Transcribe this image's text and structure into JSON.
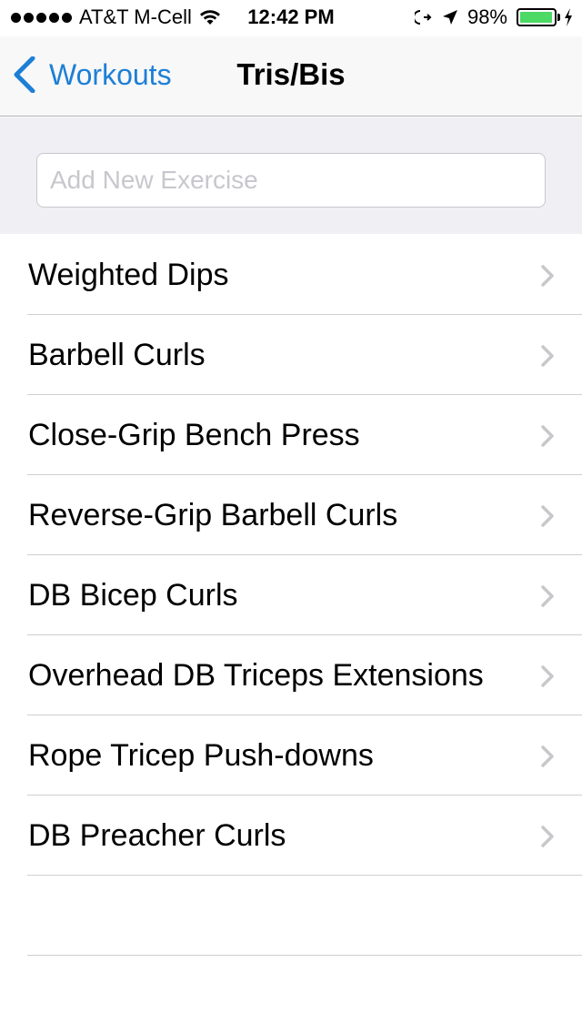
{
  "status_bar": {
    "carrier": "AT&T M-Cell",
    "time": "12:42 PM",
    "battery_percent": "98%",
    "battery_level": 0.98,
    "signal_dots": 5,
    "icons": [
      "wifi-icon",
      "rotation-lock-icon",
      "location-arrow-icon",
      "battery-icon",
      "charging-bolt-icon"
    ]
  },
  "nav": {
    "back_label": "Workouts",
    "title": "Tris/Bis"
  },
  "add_exercise": {
    "placeholder": "Add New Exercise",
    "value": ""
  },
  "exercises": [
    {
      "label": "Weighted Dips"
    },
    {
      "label": "Barbell Curls"
    },
    {
      "label": "Close-Grip Bench Press"
    },
    {
      "label": "Reverse-Grip Barbell Curls"
    },
    {
      "label": "DB Bicep Curls"
    },
    {
      "label": "Overhead DB Triceps Extensions"
    },
    {
      "label": "Rope Tricep Push-downs"
    },
    {
      "label": "DB Preacher Curls"
    }
  ],
  "colors": {
    "accent": "#1d7fd6",
    "battery": "#4cd964",
    "group_background": "#efeff4",
    "separator": "#cfcfd3",
    "chevron": "#c7c7cc"
  }
}
